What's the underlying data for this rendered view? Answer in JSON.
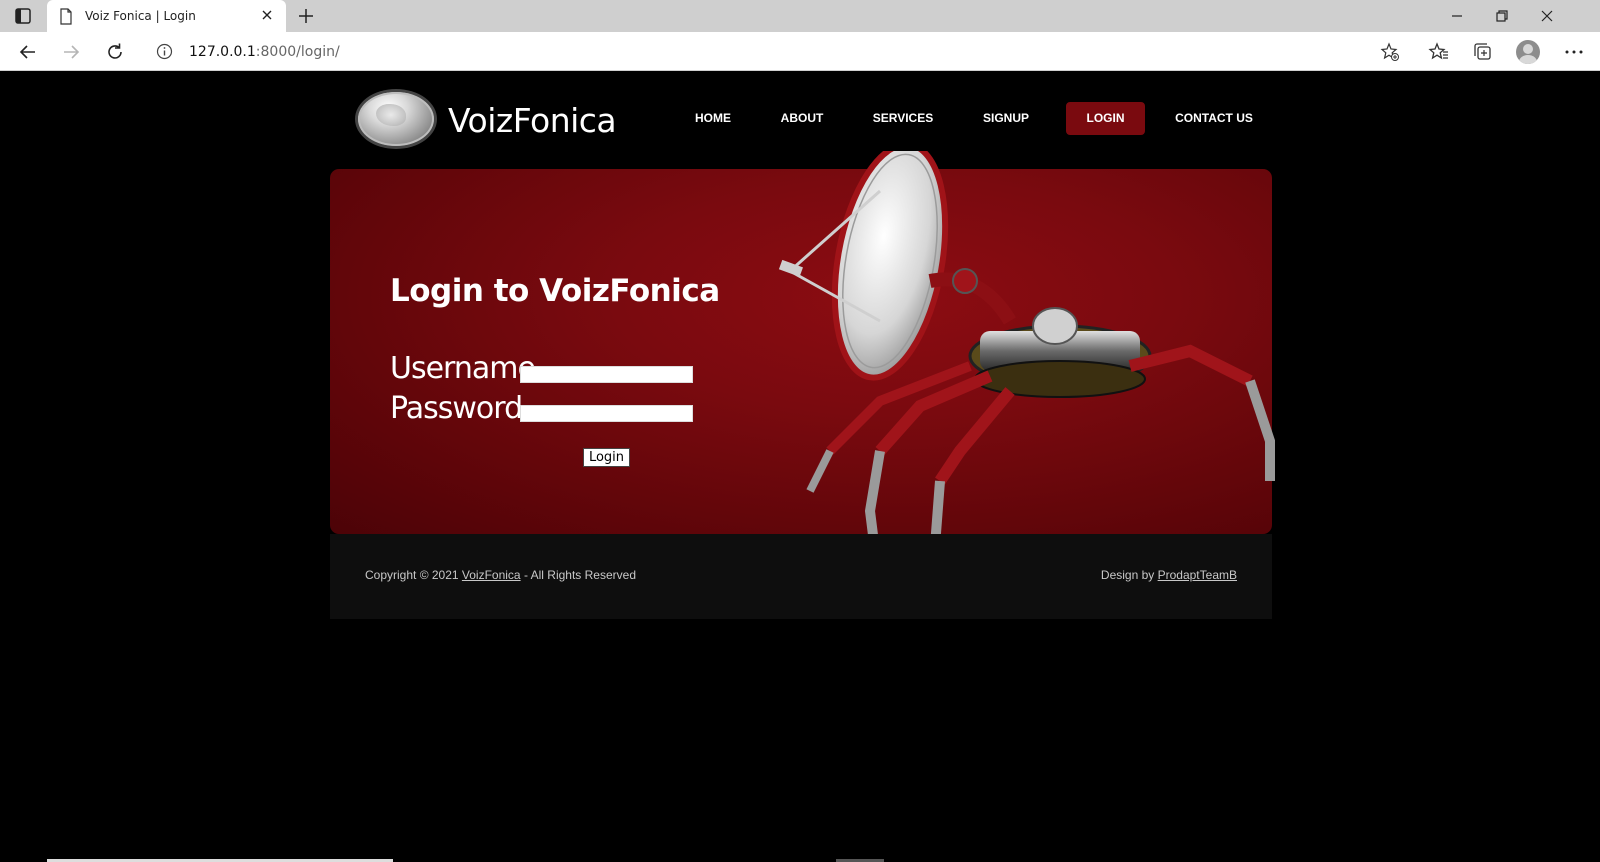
{
  "browser": {
    "tab_title": "Voiz Fonica | Login",
    "url_host": "127.0.0.1",
    "url_rest": ":8000/login/"
  },
  "site": {
    "logo_text": "VoizFonica",
    "nav": [
      {
        "label": "HOME",
        "active": false
      },
      {
        "label": "ABOUT",
        "active": false
      },
      {
        "label": "SERVICES",
        "active": false
      },
      {
        "label": "SIGNUP",
        "active": false
      },
      {
        "label": "LOGIN",
        "active": true
      },
      {
        "label": "CONTACT US",
        "active": false
      }
    ]
  },
  "login": {
    "title": "Login to VoizFonica",
    "username_label": "Username",
    "password_label": "Password",
    "username_value": "",
    "password_value": "",
    "button_label": "Login"
  },
  "footer": {
    "copyright_prefix": "Copyright © 2021 ",
    "copyright_link": "VoizFonica",
    "copyright_suffix": " - All Rights Reserved",
    "design_prefix": "Design by ",
    "design_link": "ProdaptTeamB"
  },
  "colors": {
    "accent": "#7a0a0f",
    "background": "#000000"
  }
}
